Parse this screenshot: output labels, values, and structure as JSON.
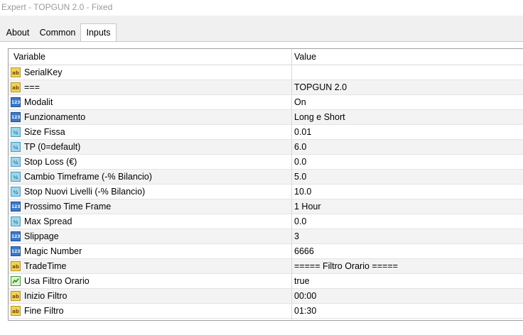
{
  "window": {
    "title": "Expert - TOPGUN 2.0 - Fixed"
  },
  "tabs": [
    {
      "label": "About"
    },
    {
      "label": "Common"
    },
    {
      "label": "Inputs"
    }
  ],
  "grid": {
    "header": {
      "variable": "Variable",
      "value": "Value"
    },
    "rows": [
      {
        "icon": "string-type-icon",
        "name": "SerialKey",
        "value": ""
      },
      {
        "icon": "string-type-icon",
        "name": "===",
        "value": "TOPGUN 2.0"
      },
      {
        "icon": "integer-type-icon",
        "name": "Modalit",
        "value": "On"
      },
      {
        "icon": "integer-type-icon",
        "name": "Funzionamento",
        "value": "Long e Short"
      },
      {
        "icon": "double-type-icon",
        "name": "Size Fissa",
        "value": "0.01"
      },
      {
        "icon": "double-type-icon",
        "name": "TP  (0=default)",
        "value": "6.0"
      },
      {
        "icon": "double-type-icon",
        "name": "Stop Loss (€)",
        "value": "0.0"
      },
      {
        "icon": "double-type-icon",
        "name": "Cambio Timeframe (-% Bilancio)",
        "value": "5.0"
      },
      {
        "icon": "double-type-icon",
        "name": "Stop Nuovi Livelli (-% Bilancio)",
        "value": "10.0"
      },
      {
        "icon": "integer-type-icon",
        "name": "Prossimo Time Frame",
        "value": "1 Hour"
      },
      {
        "icon": "double-type-icon",
        "name": "Max Spread",
        "value": "0.0"
      },
      {
        "icon": "integer-type-icon",
        "name": "Slippage",
        "value": "3"
      },
      {
        "icon": "integer-type-icon",
        "name": "Magic Number",
        "value": "6666"
      },
      {
        "icon": "string-type-icon",
        "name": "TradeTime",
        "value": "===== Filtro Orario ====="
      },
      {
        "icon": "bool-type-icon",
        "name": "Usa Filtro Orario",
        "value": "true"
      },
      {
        "icon": "string-type-icon",
        "name": "Inizio Filtro",
        "value": "00:00"
      },
      {
        "icon": "string-type-icon",
        "name": "Fine Filtro",
        "value": "01:30"
      }
    ]
  },
  "colors": {
    "string_icon": "#f2d25a",
    "integer_icon": "#3c79c9",
    "double_icon": "#9fd6ec",
    "bool_icon": "#3f9a2e",
    "alt_row": "#f3f3f3"
  }
}
